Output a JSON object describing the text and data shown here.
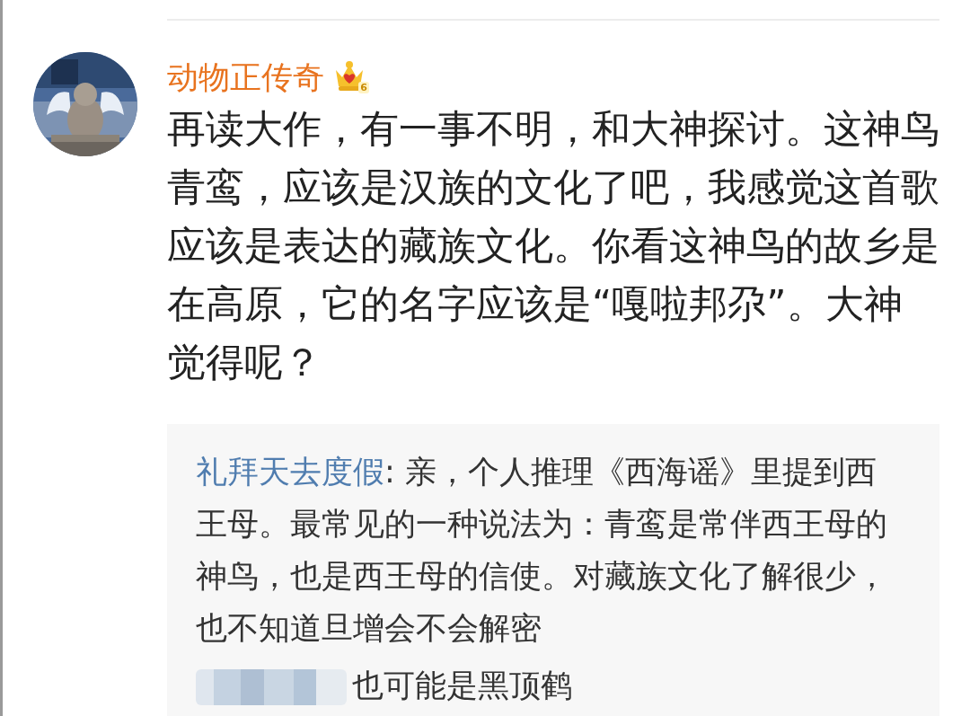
{
  "comment": {
    "author": "动物正传奇",
    "vip_level": "6",
    "text": "再读大作，有一事不明，和大神探讨。这神鸟青鸾，应该是汉族的文化了吧，我感觉这首歌应该是表达的藏族文化。你看这神鸟的故乡是在高原，它的名字应该是“嘎啦邦尕”。大神觉得呢？"
  },
  "replies": [
    {
      "kind": "named",
      "author": "礼拜天去度假",
      "text": ": 亲，个人推理《西海谣》里提到西王母。最常见的一种说法为：青鸾是常伴西王母的神鸟，也是西王母的信使。对藏族文化了解很少，也不知道旦增会不会解密"
    },
    {
      "kind": "redacted",
      "text": "也可能是黑顶鹤"
    }
  ]
}
